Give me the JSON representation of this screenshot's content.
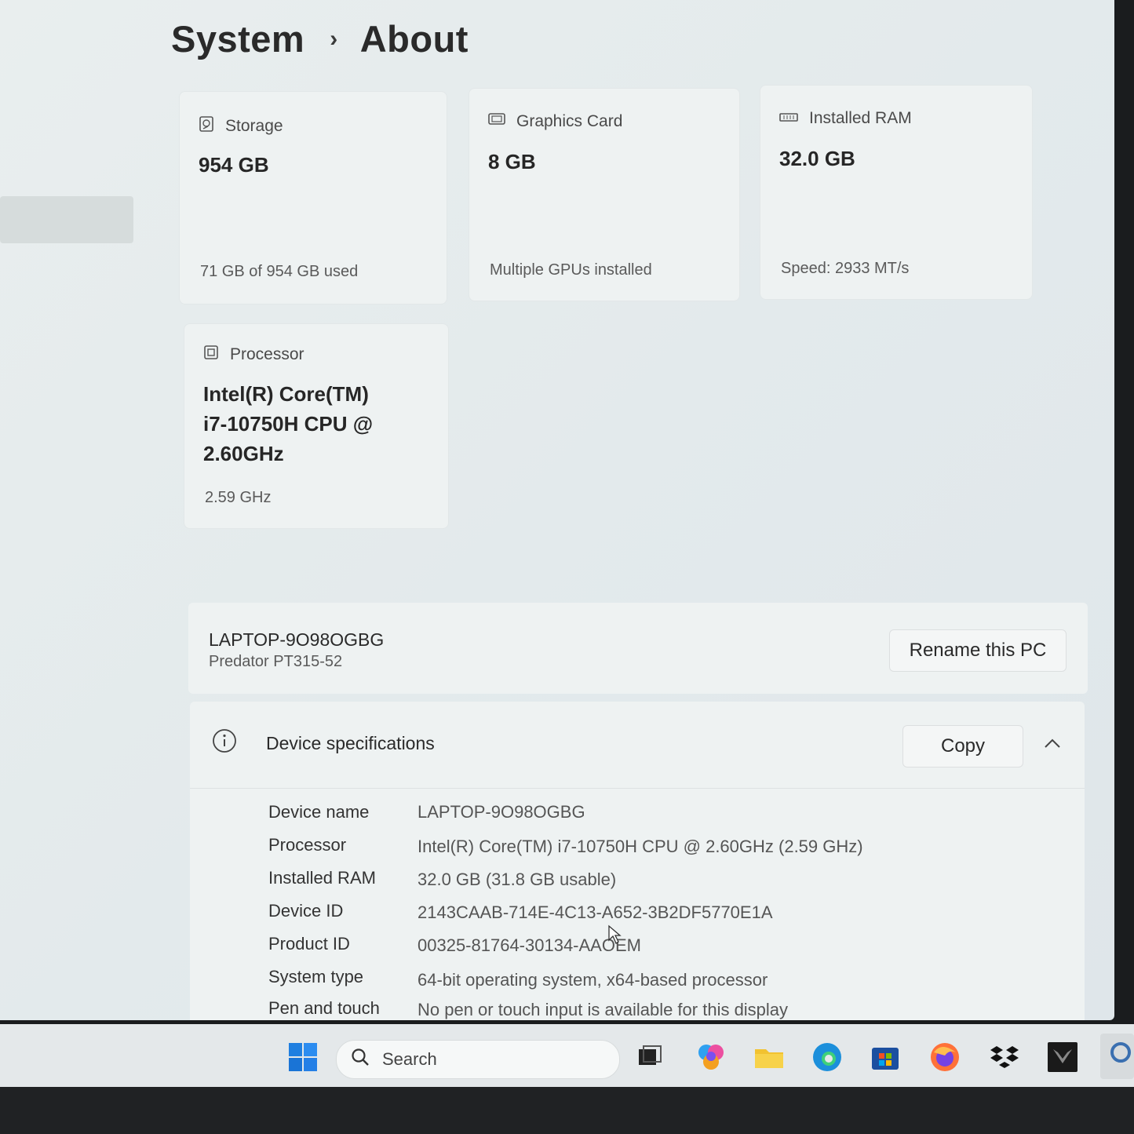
{
  "breadcrumb": {
    "parent": "System",
    "separator": "›",
    "current": "About"
  },
  "cards": {
    "storage": {
      "title": "Storage",
      "value": "954 GB",
      "sub": "71 GB of 954 GB used"
    },
    "graphics": {
      "title": "Graphics Card",
      "value": "8 GB",
      "sub": "Multiple GPUs installed"
    },
    "ram": {
      "title": "Installed RAM",
      "value": "32.0 GB",
      "sub": "Speed: 2933 MT/s"
    },
    "processor": {
      "title": "Processor",
      "value_line1": "Intel(R) Core(TM)",
      "value_line2": "i7-10750H CPU @",
      "value_line3": "2.60GHz",
      "sub": "2.59 GHz"
    }
  },
  "pc": {
    "name": "LAPTOP-9O98OGBG",
    "model": "Predator PT315-52",
    "rename_label": "Rename this PC"
  },
  "specs": {
    "title": "Device specifications",
    "copy_label": "Copy",
    "rows": [
      {
        "label": "Device name",
        "value": "LAPTOP-9O98OGBG"
      },
      {
        "label": "Processor",
        "value": "Intel(R) Core(TM) i7-10750H CPU @ 2.60GHz (2.59 GHz)"
      },
      {
        "label": "Installed RAM",
        "value": "32.0 GB (31.8 GB usable)"
      },
      {
        "label": "Device ID",
        "value": "2143CAAB-714E-4C13-A652-3B2DF5770E1A"
      },
      {
        "label": "Product ID",
        "value": "00325-81764-30134-AAOEM"
      },
      {
        "label": "System type",
        "value": "64-bit operating system, x64-based processor"
      },
      {
        "label": "Pen and touch",
        "value": "No pen or touch input is available for this display"
      }
    ]
  },
  "taskbar": {
    "search_label": "Search"
  }
}
